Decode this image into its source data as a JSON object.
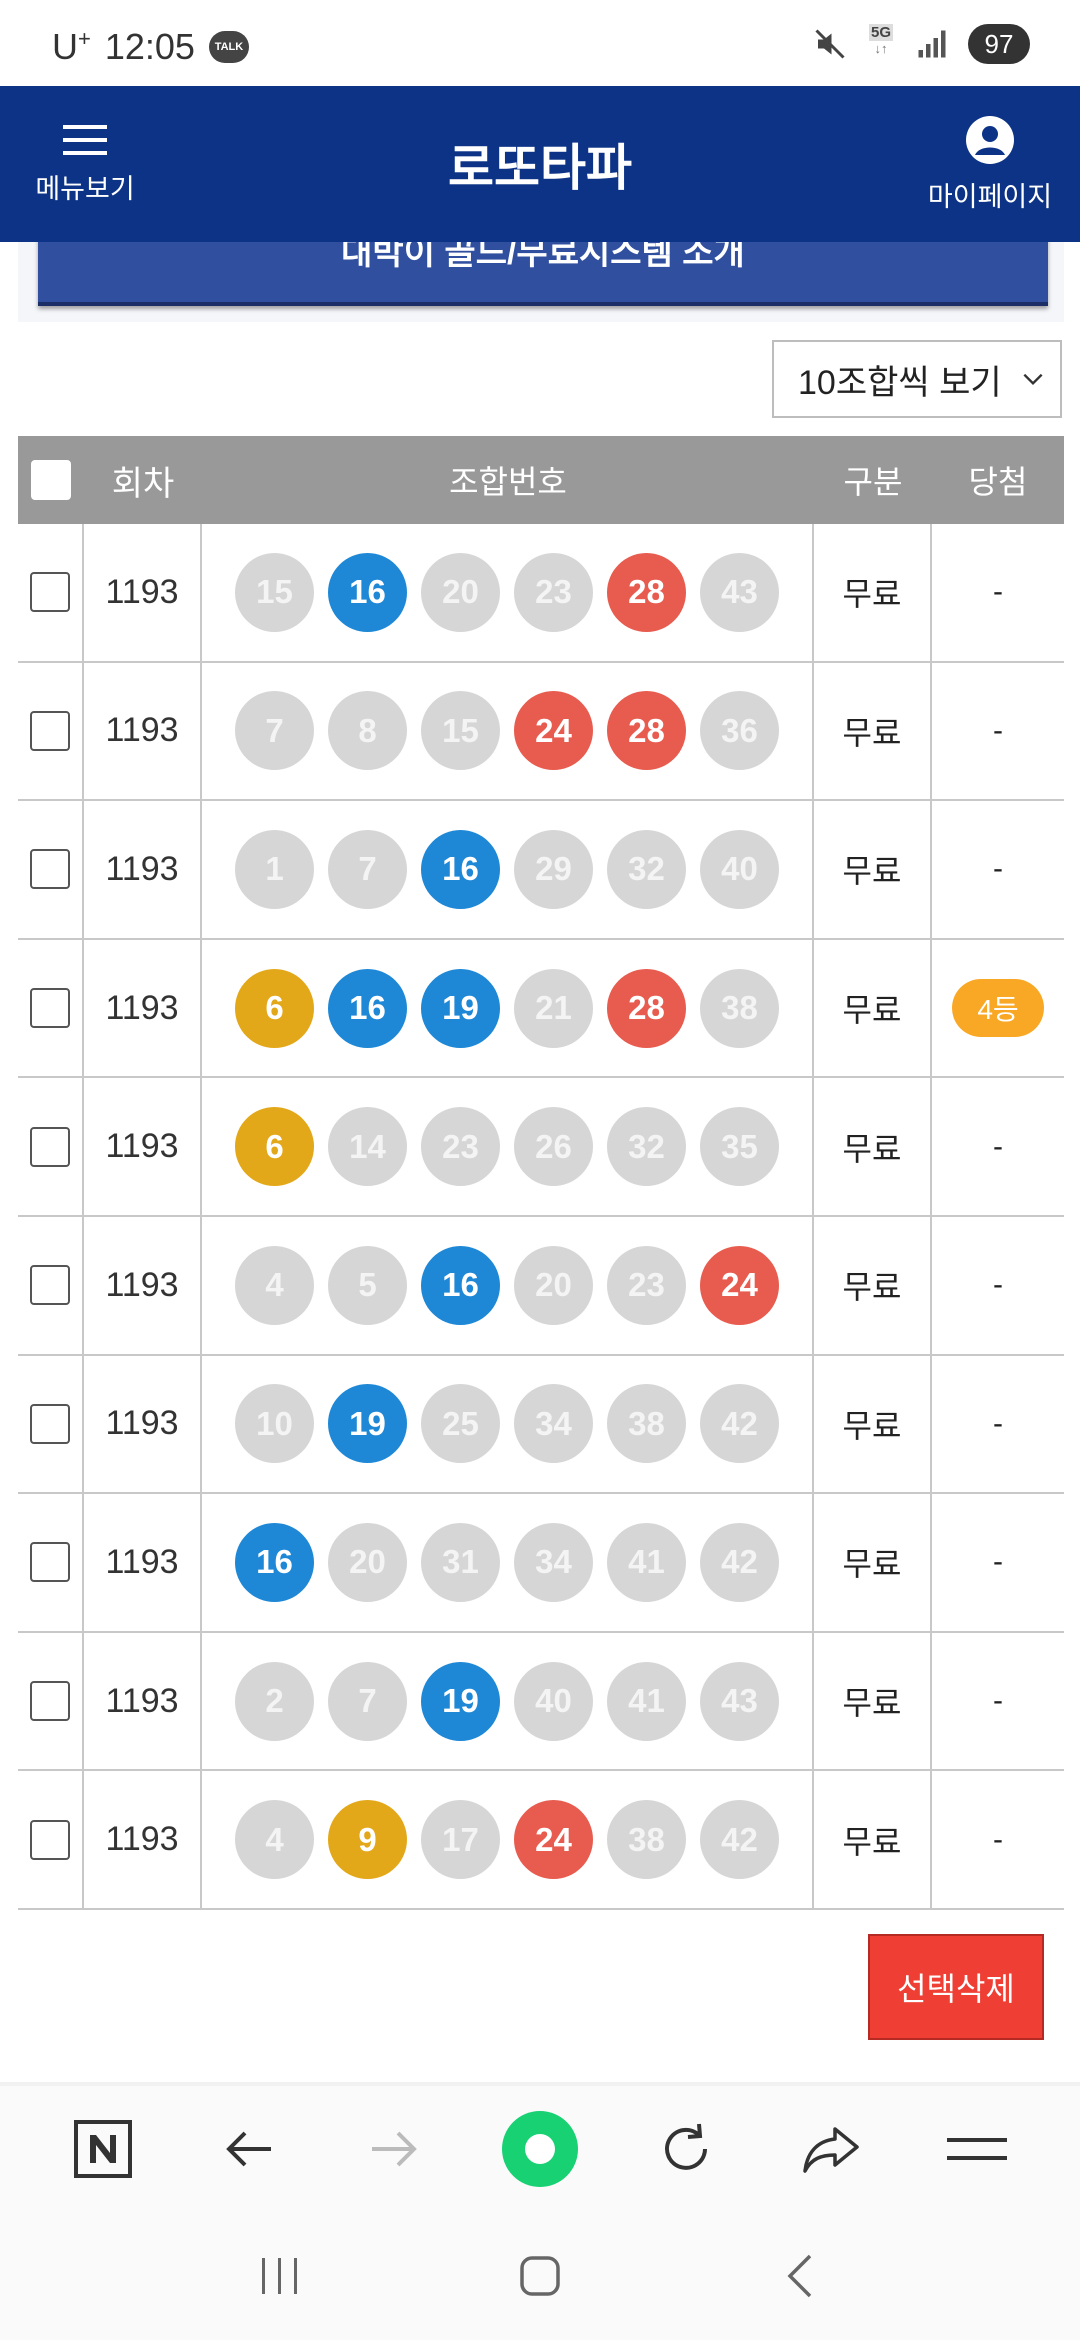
{
  "status_bar": {
    "carrier": "U",
    "carrier_sup": "+",
    "time": "12:05",
    "talk_badge": "TALK",
    "network": "5G",
    "battery": "97"
  },
  "header": {
    "title": "로또타파",
    "menu_label": "메뉴보기",
    "mypage_label": "마이페이지"
  },
  "banner": {
    "label": "대박이 골드/무료시스템 소개"
  },
  "view_select": {
    "selected": "10조합씩 보기"
  },
  "table": {
    "headers": {
      "round": "회차",
      "numbers": "조합번호",
      "type": "구분",
      "win": "당첨"
    },
    "rows": [
      {
        "round": "1193",
        "numbers": [
          {
            "n": "15",
            "c": "gray"
          },
          {
            "n": "16",
            "c": "blue"
          },
          {
            "n": "20",
            "c": "gray"
          },
          {
            "n": "23",
            "c": "gray"
          },
          {
            "n": "28",
            "c": "red"
          },
          {
            "n": "43",
            "c": "gray"
          }
        ],
        "type": "무료",
        "win": "-"
      },
      {
        "round": "1193",
        "numbers": [
          {
            "n": "7",
            "c": "gray"
          },
          {
            "n": "8",
            "c": "gray"
          },
          {
            "n": "15",
            "c": "gray"
          },
          {
            "n": "24",
            "c": "red"
          },
          {
            "n": "28",
            "c": "red"
          },
          {
            "n": "36",
            "c": "gray"
          }
        ],
        "type": "무료",
        "win": "-"
      },
      {
        "round": "1193",
        "numbers": [
          {
            "n": "1",
            "c": "gray"
          },
          {
            "n": "7",
            "c": "gray"
          },
          {
            "n": "16",
            "c": "blue"
          },
          {
            "n": "29",
            "c": "gray"
          },
          {
            "n": "32",
            "c": "gray"
          },
          {
            "n": "40",
            "c": "gray"
          }
        ],
        "type": "무료",
        "win": "-"
      },
      {
        "round": "1193",
        "numbers": [
          {
            "n": "6",
            "c": "yellow"
          },
          {
            "n": "16",
            "c": "blue"
          },
          {
            "n": "19",
            "c": "blue"
          },
          {
            "n": "21",
            "c": "gray"
          },
          {
            "n": "28",
            "c": "red"
          },
          {
            "n": "38",
            "c": "gray"
          }
        ],
        "type": "무료",
        "win": "4등",
        "win_badge": true
      },
      {
        "round": "1193",
        "numbers": [
          {
            "n": "6",
            "c": "yellow"
          },
          {
            "n": "14",
            "c": "gray"
          },
          {
            "n": "23",
            "c": "gray"
          },
          {
            "n": "26",
            "c": "gray"
          },
          {
            "n": "32",
            "c": "gray"
          },
          {
            "n": "35",
            "c": "gray"
          }
        ],
        "type": "무료",
        "win": "-"
      },
      {
        "round": "1193",
        "numbers": [
          {
            "n": "4",
            "c": "gray"
          },
          {
            "n": "5",
            "c": "gray"
          },
          {
            "n": "16",
            "c": "blue"
          },
          {
            "n": "20",
            "c": "gray"
          },
          {
            "n": "23",
            "c": "gray"
          },
          {
            "n": "24",
            "c": "red"
          }
        ],
        "type": "무료",
        "win": "-"
      },
      {
        "round": "1193",
        "numbers": [
          {
            "n": "10",
            "c": "gray"
          },
          {
            "n": "19",
            "c": "blue"
          },
          {
            "n": "25",
            "c": "gray"
          },
          {
            "n": "34",
            "c": "gray"
          },
          {
            "n": "38",
            "c": "gray"
          },
          {
            "n": "42",
            "c": "gray"
          }
        ],
        "type": "무료",
        "win": "-"
      },
      {
        "round": "1193",
        "numbers": [
          {
            "n": "16",
            "c": "blue"
          },
          {
            "n": "20",
            "c": "gray"
          },
          {
            "n": "31",
            "c": "gray"
          },
          {
            "n": "34",
            "c": "gray"
          },
          {
            "n": "41",
            "c": "gray"
          },
          {
            "n": "42",
            "c": "gray"
          }
        ],
        "type": "무료",
        "win": "-"
      },
      {
        "round": "1193",
        "numbers": [
          {
            "n": "2",
            "c": "gray"
          },
          {
            "n": "7",
            "c": "gray"
          },
          {
            "n": "19",
            "c": "blue"
          },
          {
            "n": "40",
            "c": "gray"
          },
          {
            "n": "41",
            "c": "gray"
          },
          {
            "n": "43",
            "c": "gray"
          }
        ],
        "type": "무료",
        "win": "-"
      },
      {
        "round": "1193",
        "numbers": [
          {
            "n": "4",
            "c": "gray"
          },
          {
            "n": "9",
            "c": "yellow"
          },
          {
            "n": "17",
            "c": "gray"
          },
          {
            "n": "24",
            "c": "red"
          },
          {
            "n": "38",
            "c": "gray"
          },
          {
            "n": "42",
            "c": "gray"
          }
        ],
        "type": "무료",
        "win": "-"
      }
    ]
  },
  "delete_button": {
    "label": "선택삭제"
  },
  "colors": {
    "header_bg": "#0c3386",
    "ball_yellow": "#e3a81a",
    "ball_blue": "#1e88d6",
    "ball_red": "#e85c4f",
    "ball_gray": "#d6d6d6",
    "delete_bg": "#ef3e33",
    "badge_bg": "#f9a825"
  },
  "browser_toolbar": {
    "icons": [
      "naver-n-icon",
      "back-arrow-icon",
      "forward-arrow-icon",
      "green-dot-icon",
      "refresh-icon",
      "share-icon",
      "menu-icon"
    ]
  },
  "nav_bar": {
    "icons": [
      "recent-apps-icon",
      "home-icon",
      "back-icon"
    ]
  }
}
